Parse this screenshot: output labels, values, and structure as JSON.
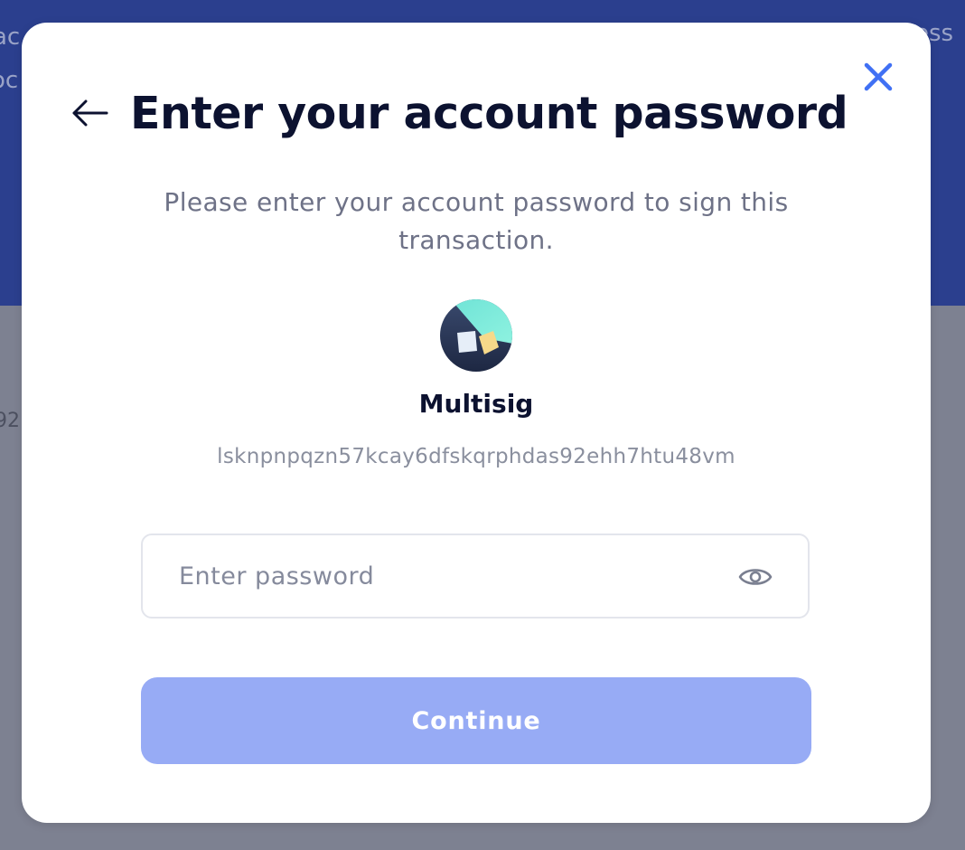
{
  "background": {
    "fragments": [
      "ac",
      "oc",
      "ess",
      "92"
    ]
  },
  "modal": {
    "title": "Enter your account password",
    "subtitle": "Please enter your account password to sign this transaction.",
    "account": {
      "name": "Multisig",
      "address": "lsknpnpqzn57kcay6dfskqrphdas92ehh7htu48vm",
      "avatar_icon": "account-avatar-icon"
    },
    "password": {
      "value": "",
      "placeholder": "Enter password",
      "toggle_icon": "eye-icon"
    },
    "continue_label": "Continue",
    "icons": {
      "back": "arrow-left-icon",
      "close": "close-icon"
    }
  },
  "colors": {
    "accent": "#4070f4",
    "button_disabled": "#97abf5",
    "header_bg": "#2b3f8e",
    "overlay": "#7d8191",
    "title": "#0c1230",
    "muted_text": "#6e7287"
  }
}
